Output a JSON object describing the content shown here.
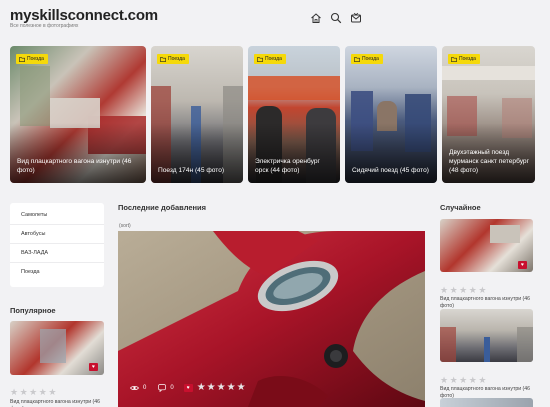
{
  "header": {
    "logo": "myskillsconnect.com",
    "tagline": "Все полезное в фотографиях",
    "icons": [
      "home-icon",
      "search-icon",
      "mail-icon"
    ]
  },
  "hero": [
    {
      "badge": "Поезда",
      "caption": "Вид плацкартного вагона изнутри (46 фото)"
    },
    {
      "badge": "Поезда",
      "caption": "Поезд 174н (45 фото)"
    },
    {
      "badge": "Поезда",
      "caption": "Электричка оренбург орск (44 фото)"
    },
    {
      "badge": "Поезда",
      "caption": "Сидячий поезд (45 фото)"
    },
    {
      "badge": "Поезда",
      "caption": "Двухэтажный поезд мурманск санкт петербург (48 фото)"
    }
  ],
  "categories": [
    "Самолеты",
    "Автобусы",
    "ВАЗ-ЛАДА",
    "Поезда"
  ],
  "sections": {
    "popular": "Популярное",
    "latest": "Последние добавления",
    "random": "Случайное"
  },
  "sort_label": "(sort)",
  "main_post": {
    "views": "0",
    "comments": "0"
  },
  "popular_item": {
    "caption": "Вид плацкартного вагона изнутри (46 фото)"
  },
  "random_items": [
    {
      "caption": "Вид плацкартного вагона изнутри (46 фото)"
    },
    {
      "caption": "Вид плацкартного вагона изнутри (46 фото)"
    }
  ],
  "colors": {
    "accent": "#c8102e",
    "badge": "#f5d90a",
    "background": "#f2f2f4"
  }
}
